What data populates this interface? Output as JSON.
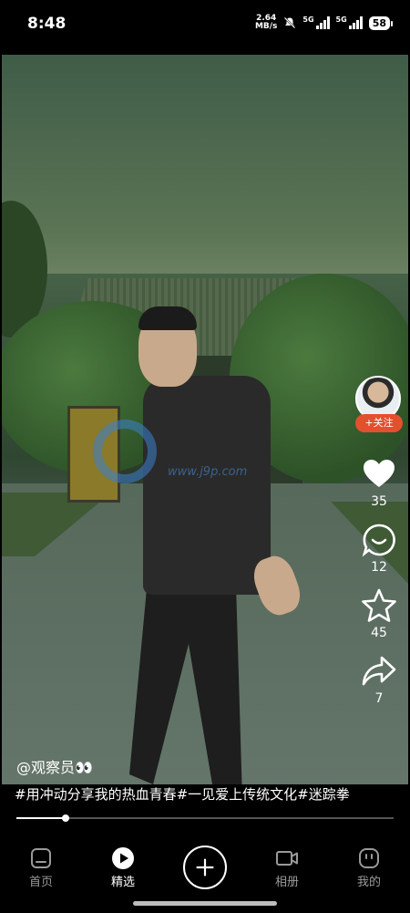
{
  "status_bar": {
    "time": "8:48",
    "net_speed_value": "2.64",
    "net_speed_unit": "MB/s",
    "signal1_label": "5G",
    "signal2_label": "5G",
    "battery": "58",
    "icons": [
      "mute-bell-icon",
      "signal-icon",
      "signal-icon",
      "battery-icon"
    ]
  },
  "video": {
    "watermark_text": "www.j9p.com",
    "progress_percent": 13
  },
  "side_bar": {
    "follow_label": "+关注",
    "likes": "35",
    "comments": "12",
    "favorites": "45",
    "shares": "7"
  },
  "post": {
    "author": "@观察员👀",
    "caption": "#用冲动分享我的热血青春#一见爱上传统文化#迷踪拳"
  },
  "bottom_nav": {
    "items": [
      {
        "label": "首页",
        "icon": "home-icon",
        "active": false
      },
      {
        "label": "精选",
        "icon": "play-circle-icon",
        "active": true
      },
      {
        "label": "",
        "icon": "plus-icon",
        "active": false
      },
      {
        "label": "相册",
        "icon": "video-camera-icon",
        "active": false
      },
      {
        "label": "我的",
        "icon": "profile-icon",
        "active": false
      }
    ]
  },
  "colors": {
    "follow_button": "#e2502e",
    "background": "#000000",
    "inactive_nav": "#9a9a9a"
  }
}
